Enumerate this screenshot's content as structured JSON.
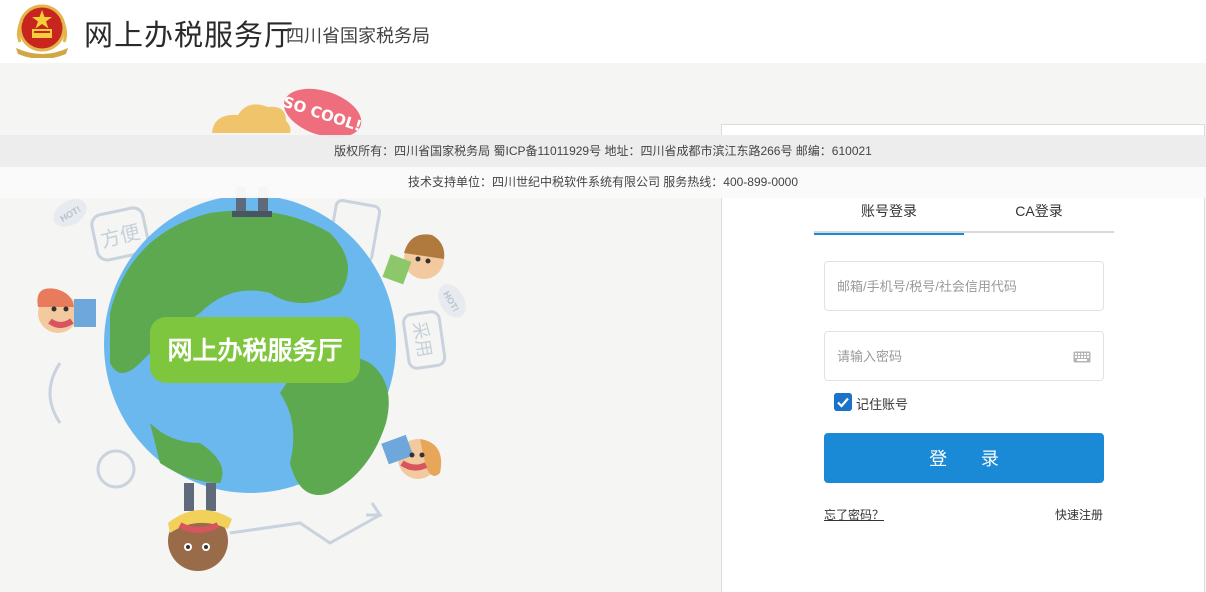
{
  "header": {
    "title": "网上办税服务厅",
    "subtitle": "四川省国家税务局"
  },
  "illustration": {
    "globe_label": "网上办税服务厅",
    "bubble_text": "SO COOL!",
    "sticker_1": "方便",
    "sticker_2": "HOT!",
    "sticker_3": "HOT!",
    "sticker_4": "采用"
  },
  "login": {
    "tabs": [
      {
        "label": "账号登录",
        "active": true
      },
      {
        "label": "CA登录",
        "active": false
      }
    ],
    "username_placeholder": "邮箱/手机号/税号/社会信用代码",
    "password_placeholder": "请输入密码",
    "remember_label": "记住账号",
    "remember_checked": true,
    "login_button": "登  录",
    "forgot_link": "忘了密码？",
    "register_link": "快速注册"
  },
  "footer": {
    "copyright": "版权所有：四川省国家税务局 蜀ICP备11011929号 地址：四川省成都市滨江东路266号 邮编：610021",
    "support": "技术支持单位：四川世纪中税软件系统有限公司 服务热线：400-899-0000"
  },
  "colors": {
    "accent": "#1a8ad6",
    "globe_ocean": "#6bb8ef",
    "globe_land": "#5ca94f",
    "label_green": "#7fc63f"
  }
}
